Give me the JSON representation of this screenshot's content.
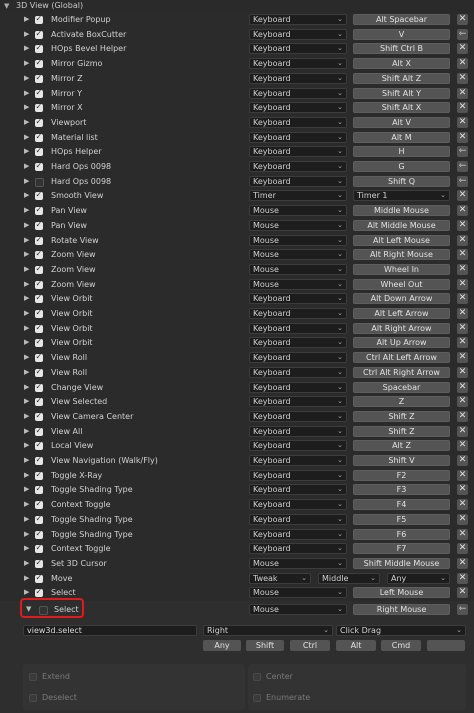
{
  "header": {
    "title": "3D View (Global)"
  },
  "rows": [
    {
      "name": "Modifier Popup",
      "checked": true,
      "type": "Keyboard",
      "key": "Alt Spacebar",
      "action": "x"
    },
    {
      "name": "Activate BoxCutter",
      "checked": true,
      "type": "Keyboard",
      "key": "V",
      "action": "back"
    },
    {
      "name": "HOps Bevel Helper",
      "checked": true,
      "type": "Keyboard",
      "key": "Shift Ctrl B",
      "action": "x"
    },
    {
      "name": "Mirror Gizmo",
      "checked": true,
      "type": "Keyboard",
      "key": "Alt X",
      "action": "x"
    },
    {
      "name": "Mirror Z",
      "checked": true,
      "type": "Keyboard",
      "key": "Shift Alt Z",
      "action": "x"
    },
    {
      "name": "Mirror Y",
      "checked": true,
      "type": "Keyboard",
      "key": "Shift Alt Y",
      "action": "x"
    },
    {
      "name": "Mirror X",
      "checked": true,
      "type": "Keyboard",
      "key": "Shift Alt X",
      "action": "x"
    },
    {
      "name": "Viewport",
      "checked": true,
      "type": "Keyboard",
      "key": "Alt V",
      "action": "x"
    },
    {
      "name": "Material list",
      "checked": true,
      "type": "Keyboard",
      "key": "Alt M",
      "action": "x"
    },
    {
      "name": "HOps Helper",
      "checked": true,
      "type": "Keyboard",
      "key": "H",
      "action": "back"
    },
    {
      "name": "Hard Ops 0098",
      "checked": true,
      "type": "Keyboard",
      "key": "G",
      "action": "back"
    },
    {
      "name": "Hard Ops 0098",
      "checked": false,
      "type": "Keyboard",
      "key": "Shift Q",
      "action": "back"
    },
    {
      "name": "Smooth View",
      "checked": true,
      "type": "Timer",
      "key": "Timer 1",
      "timer": true,
      "action": "x"
    },
    {
      "name": "Pan View",
      "checked": true,
      "type": "Mouse",
      "key": "Middle Mouse",
      "action": "x"
    },
    {
      "name": "Pan View",
      "checked": true,
      "type": "Mouse",
      "key": "Alt Middle Mouse",
      "action": "x"
    },
    {
      "name": "Rotate View",
      "checked": true,
      "type": "Mouse",
      "key": "Alt Left Mouse",
      "action": "x"
    },
    {
      "name": "Zoom View",
      "checked": true,
      "type": "Mouse",
      "key": "Alt Right Mouse",
      "action": "x"
    },
    {
      "name": "Zoom View",
      "checked": true,
      "type": "Mouse",
      "key": "Wheel In",
      "action": "x"
    },
    {
      "name": "Zoom View",
      "checked": true,
      "type": "Mouse",
      "key": "Wheel Out",
      "action": "x"
    },
    {
      "name": "View Orbit",
      "checked": true,
      "type": "Keyboard",
      "key": "Alt Down Arrow",
      "action": "x"
    },
    {
      "name": "View Orbit",
      "checked": true,
      "type": "Keyboard",
      "key": "Alt Left Arrow",
      "action": "x"
    },
    {
      "name": "View Orbit",
      "checked": true,
      "type": "Keyboard",
      "key": "Alt Right Arrow",
      "action": "x"
    },
    {
      "name": "View Orbit",
      "checked": true,
      "type": "Keyboard",
      "key": "Alt Up Arrow",
      "action": "x"
    },
    {
      "name": "View Roll",
      "checked": true,
      "type": "Keyboard",
      "key": "Ctrl Alt Left Arrow",
      "action": "x"
    },
    {
      "name": "View Roll",
      "checked": true,
      "type": "Keyboard",
      "key": "Ctrl Alt Right Arrow",
      "action": "x"
    },
    {
      "name": "Change View",
      "checked": true,
      "type": "Keyboard",
      "key": "Spacebar",
      "action": "x"
    },
    {
      "name": "View Selected",
      "checked": true,
      "type": "Keyboard",
      "key": "Z",
      "action": "x"
    },
    {
      "name": "View Camera Center",
      "checked": true,
      "type": "Keyboard",
      "key": "Shift Z",
      "action": "x"
    },
    {
      "name": "View All",
      "checked": true,
      "type": "Keyboard",
      "key": "Shift Z",
      "action": "x"
    },
    {
      "name": "Local View",
      "checked": true,
      "type": "Keyboard",
      "key": "Alt Z",
      "action": "x"
    },
    {
      "name": "View Navigation (Walk/Fly)",
      "checked": true,
      "type": "Keyboard",
      "key": "Shift V",
      "action": "x"
    },
    {
      "name": "Toggle X-Ray",
      "checked": true,
      "type": "Keyboard",
      "key": "F2",
      "action": "x"
    },
    {
      "name": "Toggle Shading Type",
      "checked": true,
      "type": "Keyboard",
      "key": "F3",
      "action": "x"
    },
    {
      "name": "Context Toggle",
      "checked": true,
      "type": "Keyboard",
      "key": "F4",
      "action": "x"
    },
    {
      "name": "Toggle Shading Type",
      "checked": true,
      "type": "Keyboard",
      "key": "F5",
      "action": "x"
    },
    {
      "name": "Toggle Shading Type",
      "checked": true,
      "type": "Keyboard",
      "key": "F6",
      "action": "x"
    },
    {
      "name": "Context Toggle",
      "checked": true,
      "type": "Keyboard",
      "key": "F7",
      "action": "x"
    },
    {
      "name": "Set 3D Cursor",
      "checked": true,
      "type": "Mouse",
      "key": "Shift Middle Mouse",
      "action": "x"
    },
    {
      "name": "Move",
      "checked": true,
      "type": "Tweak",
      "tweak": true,
      "tweak_button": "Middle",
      "tweak_dir": "Any",
      "action": "x"
    },
    {
      "name": "Select",
      "checked": true,
      "type": "Mouse",
      "key": "Left Mouse",
      "action": "x"
    }
  ],
  "expanded": {
    "name": "Select",
    "type": "Mouse",
    "key": "Right Mouse",
    "idname": "view3d.select",
    "value": "Right",
    "mode": "Click Drag",
    "modifiers": [
      "Any",
      "Shift",
      "Ctrl",
      "Alt",
      "Cmd",
      ""
    ],
    "options": {
      "extend": "Extend",
      "deselect": "Deselect",
      "center": "Center",
      "enumerate": "Enumerate"
    }
  },
  "icons": {
    "expand": "triangle-right-icon",
    "collapse": "triangle-down-icon",
    "remove": "x-icon",
    "restore": "back-arrow-icon"
  }
}
